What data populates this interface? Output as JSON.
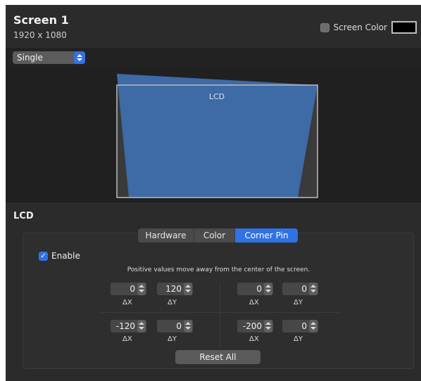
{
  "header": {
    "title": "Screen 1",
    "resolution": "1920 x 1080",
    "screen_color_label": "Screen Color",
    "screen_color_checked": false,
    "screen_color_swatch": "#000000"
  },
  "mode": {
    "selected": "Single"
  },
  "preview": {
    "label": "LCD",
    "fill_color": "#3e6aa6",
    "outline_color": "#bcbcbc"
  },
  "section": {
    "title": "LCD",
    "tabs": [
      {
        "label": "Hardware",
        "active": false
      },
      {
        "label": "Color",
        "active": false
      },
      {
        "label": "Corner Pin",
        "active": true
      }
    ],
    "enable_label": "Enable",
    "enable_checked": true,
    "note": "Positive values move away from the center of the screen.",
    "corners": [
      {
        "dx": "0",
        "dy": "120",
        "dx_label": "ΔX",
        "dy_label": "ΔY"
      },
      {
        "dx": "0",
        "dy": "0",
        "dx_label": "ΔX",
        "dy_label": "ΔY"
      },
      {
        "dx": "-120",
        "dy": "0",
        "dx_label": "ΔX",
        "dy_label": "ΔY"
      },
      {
        "dx": "-200",
        "dy": "0",
        "dx_label": "ΔX",
        "dy_label": "ΔY"
      }
    ],
    "reset_label": "Reset All"
  },
  "colors": {
    "accent": "#2f72e6",
    "background": "#2b2b2b"
  }
}
